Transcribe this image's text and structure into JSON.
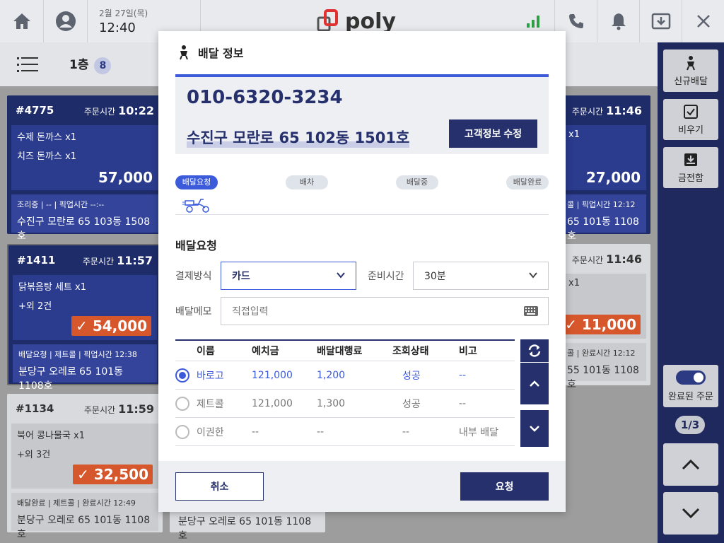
{
  "topbar": {
    "date": "2월 27일(목)",
    "time": "12:40",
    "logo": "poly"
  },
  "subbar": {
    "floor": "1층",
    "count": "8"
  },
  "cards": [
    {
      "no": "#4775",
      "time_label": "주문시간",
      "time": "10:22",
      "items": [
        "수제 돈까스  x1",
        "치즈 돈까스  x1"
      ],
      "price": "57,000",
      "status": "조리중   |   --   |  픽업시간 --:--",
      "address": "수진구 모란로 65 103동 1508호"
    },
    {
      "no": "#1411",
      "time_label": "주문시간",
      "time": "11:57",
      "items": [
        "닭볶음탕 세트  x1",
        "+외 2건"
      ],
      "price": "✓ 54,000",
      "status": "배달요청  |  제트콜  |  픽업시간 12:38",
      "address": "분당구 오레로 65 101동 1108호"
    },
    {
      "no": "#1134",
      "time_label": "주문시간",
      "time": "11:59",
      "items": [
        "북어 콩나물국  x1",
        "+외 3건"
      ],
      "price": "✓ 32,500",
      "status": "배달완료  |  제트콜  |  완료시간 12:49",
      "address": "분당구 오레로 65 101동 1108호"
    },
    {
      "time_label": "주문시간",
      "time": "11:46",
      "items": [
        "x1"
      ],
      "price": "27,000",
      "status": "콜   |  픽업시간 12:12",
      "address": "65 101동 1108호"
    },
    {
      "time_label": "주문시간",
      "time": "11:46",
      "items": [
        "x1"
      ],
      "price": "✓ 11,000",
      "status": "콜   |  완료시간 12:12",
      "address": "55 101동 1108호"
    },
    {
      "address": "분당구 오레로 65 101동 1108호"
    }
  ],
  "sidebar": {
    "new_delivery": "신규배달",
    "clear": "비우기",
    "cash_drawer": "금전함",
    "completed_orders": "완료된 주문",
    "page": "1/3"
  },
  "modal": {
    "title": "배달 정보",
    "phone": "010-6320-3234",
    "address": "수진구 모란로 65 102동 1501호",
    "edit_button": "고객정보 수정",
    "steps": [
      "배달요청",
      "배차",
      "배달중",
      "배달완료"
    ],
    "section_title": "배달요청",
    "payment_label": "결제방식",
    "payment_value": "카드",
    "prep_label": "준비시간",
    "prep_value": "30분",
    "memo_label": "배달메모",
    "memo_placeholder": "직접입력",
    "table": {
      "headers": [
        "이름",
        "예치금",
        "배달대행료",
        "조회상태",
        "비고"
      ],
      "rows": [
        {
          "name": "바로고",
          "deposit": "121,000",
          "fee": "1,200",
          "status": "성공",
          "note": "--",
          "selected": true
        },
        {
          "name": "제트콜",
          "deposit": "121,000",
          "fee": "1,300",
          "status": "성공",
          "note": "--",
          "selected": false
        },
        {
          "name": "이권한",
          "deposit": "--",
          "fee": "--",
          "status": "--",
          "note": "내부 배달",
          "selected": false
        }
      ]
    },
    "cancel_button": "취소",
    "request_button": "요청"
  },
  "colors": {
    "primary": "#25306d",
    "accent": "#3b5bdb",
    "price_tag": "#d6572c",
    "signal": "#2f9e44"
  }
}
